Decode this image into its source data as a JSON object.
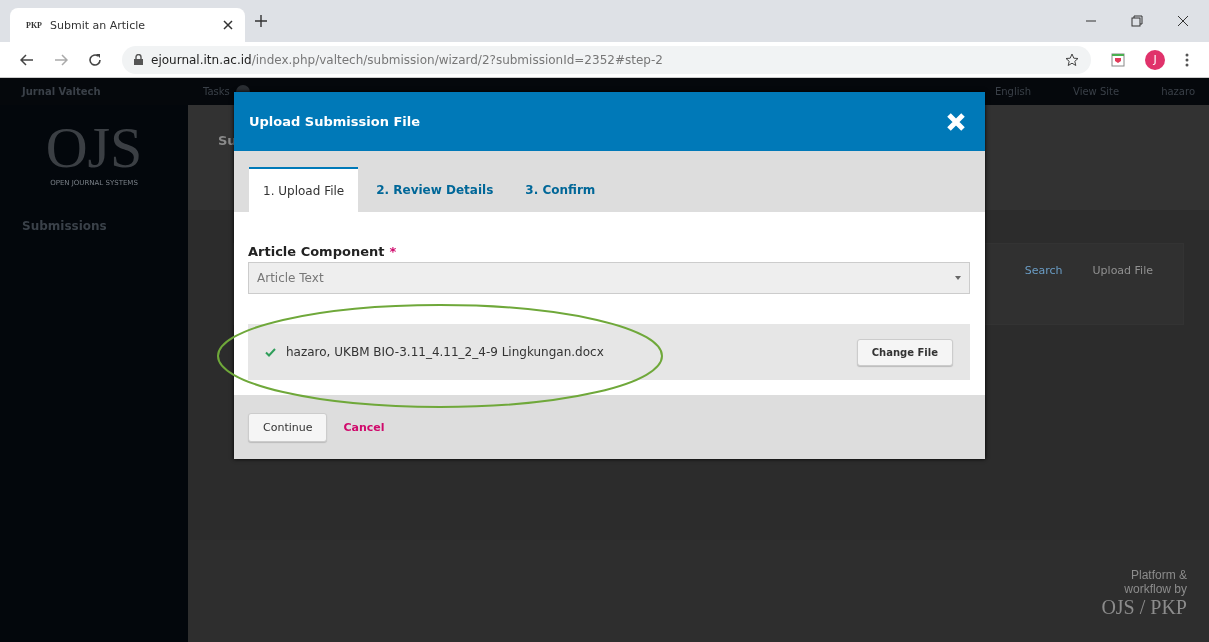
{
  "browser": {
    "tab_title": "Submit an Article",
    "tab_favicon": "PKP",
    "url_host": "ejournal.itn.ac.id",
    "url_path": "/index.php/valtech/submission/wizard/2?submissionId=2352#step-2",
    "profile_initial": "J"
  },
  "topbar": {
    "site": "Jurnal Valtech",
    "tasks": "Tasks",
    "language": "English",
    "view_site": "View Site",
    "user": "hazaro"
  },
  "sidebar": {
    "logo": "OJS",
    "logo_sub": "OPEN JOURNAL SYSTEMS",
    "items": [
      {
        "label": "Submissions",
        "selected": true
      }
    ]
  },
  "main": {
    "heading": "Su",
    "search": "Search",
    "upload": "Upload File"
  },
  "footer": {
    "line1": "Platform &",
    "line2": "workflow by",
    "brand": "OJS / PKP"
  },
  "modal": {
    "title": "Upload Submission File",
    "tabs": [
      {
        "label": "1. Upload File",
        "selected": true
      },
      {
        "label": "2. Review Details",
        "selected": false
      },
      {
        "label": "3. Confirm",
        "selected": false
      }
    ],
    "field_label": "Article Component",
    "required_mark": "*",
    "select_value": "Article Text",
    "file": {
      "name": "hazaro, UKBM BIO-3.11_4.11_2_4-9 Lingkungan.docx",
      "uploaded": true,
      "button": "Change File"
    },
    "buttons": [
      {
        "label": "Continue",
        "kind": "primary"
      },
      {
        "label": "Cancel",
        "kind": "link"
      }
    ]
  }
}
